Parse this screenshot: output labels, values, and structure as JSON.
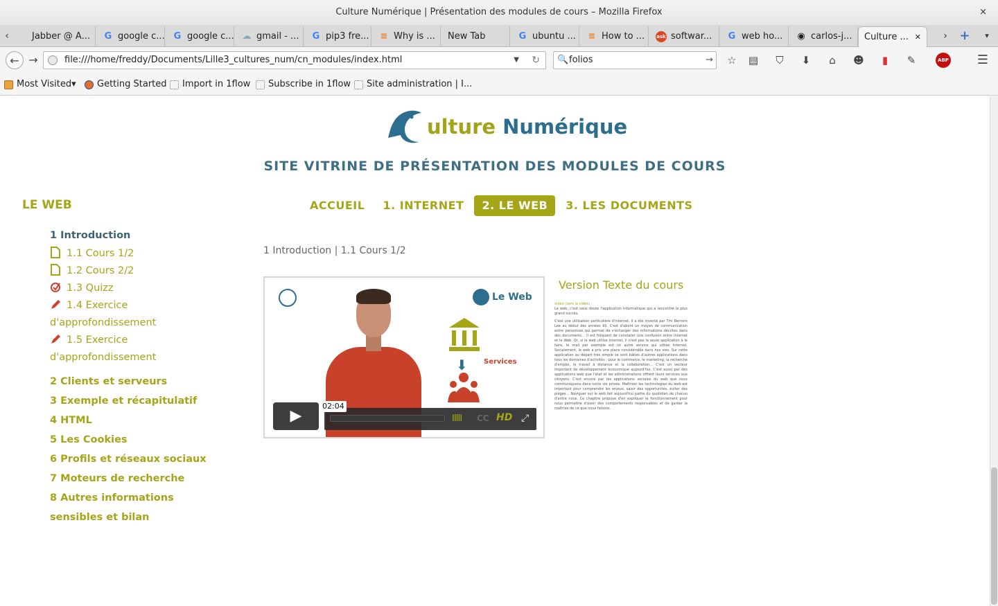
{
  "window": {
    "title": "Culture Numérique | Présentation des modules de cours – Mozilla Firefox",
    "close": "×"
  },
  "tabs": [
    {
      "label": "Jabber @ A...",
      "icon": ""
    },
    {
      "label": "google c...",
      "icon": "G"
    },
    {
      "label": "google c...",
      "icon": "G"
    },
    {
      "label": "gmail - ...",
      "icon": "☁"
    },
    {
      "label": "pip3 fre...",
      "icon": "G"
    },
    {
      "label": "Why is ...",
      "icon": "≡"
    },
    {
      "label": "New Tab",
      "icon": ""
    },
    {
      "label": "ubuntu ...",
      "icon": "G"
    },
    {
      "label": "How to ...",
      "icon": "≡"
    },
    {
      "label": "softwar...",
      "icon": "ask"
    },
    {
      "label": "web ho...",
      "icon": "G"
    },
    {
      "label": "carlos-j...",
      "icon": "◉"
    },
    {
      "label": "Culture ...",
      "icon": ""
    }
  ],
  "tabs_ui": {
    "active_close": "✕",
    "scroll_left": "‹",
    "scroll_right": "›",
    "new_tab": "+",
    "list": "▾"
  },
  "navbar": {
    "back": "←",
    "forward": "→",
    "url": "file:///home/freddy/Documents/Lille3_cultures_num/cn_modules/index.html",
    "url_dropdown": "▼",
    "reload": "↻",
    "search_value": "folios",
    "search_icon": "🔍",
    "search_go": "→",
    "tools": [
      "☆",
      "▤",
      "⛉",
      "⬇",
      "⌂",
      "☻",
      "▮",
      "✎",
      "ABP",
      "☰"
    ]
  },
  "bookmarks": [
    {
      "label": "Most Visited▾"
    },
    {
      "label": "Getting Started"
    },
    {
      "label": "Import in 1flow"
    },
    {
      "label": "Subscribe in 1flow"
    },
    {
      "label": "Site administration | I..."
    }
  ],
  "site": {
    "logo_word1": "ulture",
    "logo_word2": "Numérique",
    "subtitle": "SITE VITRINE DE PRÉSENTATION DES MODULES DE COURS",
    "side_title": "LE WEB",
    "nav": [
      "ACCUEIL",
      "1. INTERNET",
      "2. LE WEB",
      "3. LES DOCUMENTS"
    ],
    "nav_active": "2. LE WEB",
    "breadcrumb": "1 Introduction | 1.1 Cours 1/2",
    "sections": {
      "intro": "1 Introduction",
      "items": [
        "1.1 Cours 1/2",
        "1.2 Cours 2/2",
        "1.3 Quizz",
        "1.4 Exercice",
        "d'approfondissement",
        "1.5 Exercice",
        "d'approfondissement"
      ],
      "others": [
        "2 Clients et serveurs",
        "3 Exemple et récapitulatif",
        "4 HTML",
        "5 Les Cookies",
        "6 Profils et réseaux sociaux",
        "7 Moteurs de recherche",
        "8 Autres informations",
        "sensibles et bilan"
      ]
    },
    "video": {
      "timecode": "02:04",
      "brand_label": "Le Web",
      "services_label": "Services",
      "play": "▶",
      "hd": "HD",
      "cc": "CC",
      "volume": "IIIII",
      "fullscreen": "⤢"
    },
    "text_version": {
      "title": "Version Texte du cours",
      "link": "vidéo (vers la vidéo)",
      "p1": "Le web, c'est sans doute l'application informatique qui a rencontré le plus grand succès.",
      "p2": "C'est une utilisation particulière d'internet, il a été inventé par Tim Berners Lee au début des années 90. C'est d'abord un moyen de communication entre personnes qui permet de s'échanger des informations décrites dans des documents… Il est fréquent de constater une confusion entre Internet et le Web. Or, si le web utilise internet, il n'est pas la seule application à le faire, le mail par exemple est un autre service qui utilise Internet. Socialement, le web a pris une place considérable dans nos vies. Sur cette application au départ très simple se sont bâties d'autres applications dans tous les domaines d'activités : pour le commerce, le marketing, la recherche d'emploi, le travail à distance et la collaboration… C'est un vecteur important de développement économique aujourd'hui. C'est aussi par des applications web que l'état et les administrations offrent leurs services aux citoyens. C'est encore par les applications sociales du web que nous communiquons dans notre vie privée. Maîtriser les technologies du web est important pour comprendre les enjeux, saisir des opportunités, éviter des pièges… Naviguer sur le web fait aujourd'hui partie du quotidien de chacun d'entre nous. Ce chapitre propose d'en expliquer le fonctionnement pour nous permettre d'avoir des comportements responsables et de garder la maîtrise de ce que nous faisons."
    }
  },
  "colors": {
    "accent": "#a5a518",
    "brand_blue": "#2c6e8e",
    "heading": "#3e6f82",
    "current_section": "#3d6373"
  }
}
